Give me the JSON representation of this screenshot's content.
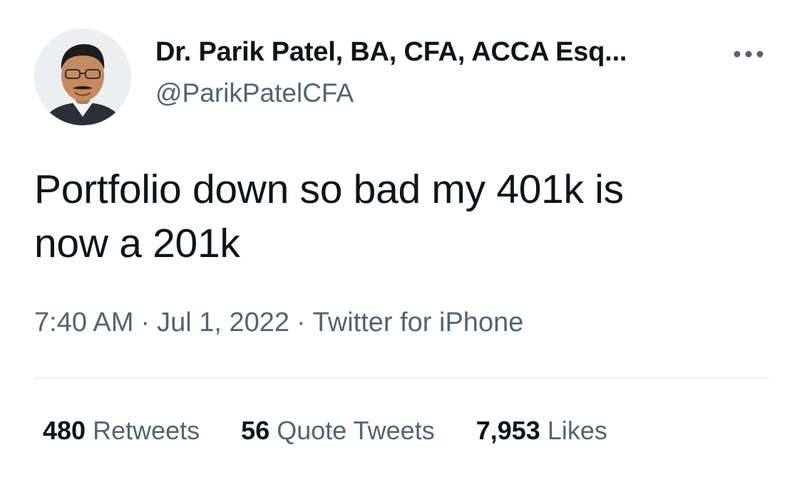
{
  "tweet": {
    "author": {
      "display_name": "Dr. Parik Patel, BA, CFA, ACCA Esq...",
      "handle": "@ParikPatelCFA"
    },
    "text_line1": "Portfolio down so bad my 401k is",
    "text_line2": "now a 201k",
    "time": "7:40 AM",
    "separator": "·",
    "date": "Jul 1, 2022",
    "source": "Twitter for iPhone",
    "stats": {
      "retweets_count": "480",
      "retweets_label": "Retweets",
      "quotes_count": "56",
      "quotes_label": "Quote Tweets",
      "likes_count": "7,953",
      "likes_label": "Likes"
    }
  },
  "icons": {
    "more": "more-horizontal-icon"
  },
  "colors": {
    "primary_text": "#0f1419",
    "secondary_text": "#536471",
    "divider": "#eff3f4",
    "background": "#ffffff"
  }
}
